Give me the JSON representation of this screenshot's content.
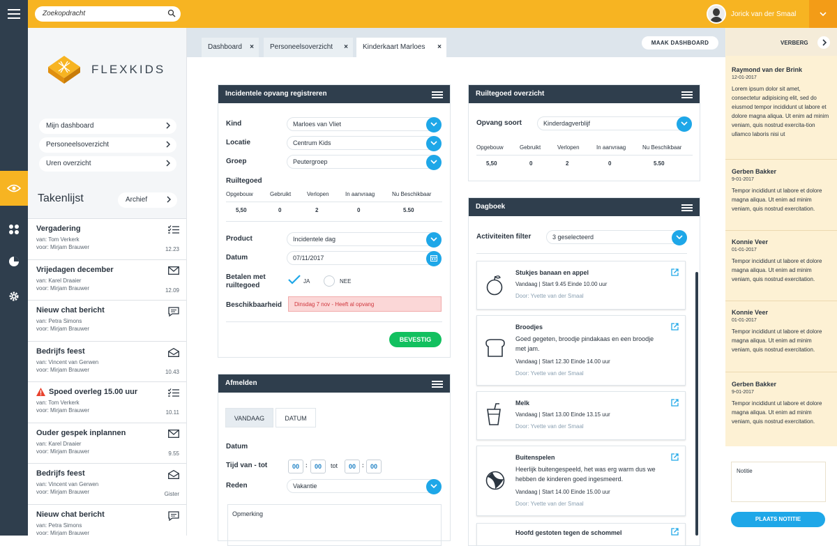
{
  "colors": {
    "accent": "#f7b422",
    "dark": "#2f3e4d",
    "blue": "#1ea7e8",
    "green": "#12c05f",
    "danger": "#d0363d"
  },
  "topbar": {
    "search_placeholder": "Zoekopdracht",
    "user_name": "Jorick van der Smaal"
  },
  "brand": {
    "name": "FLEXKIDS"
  },
  "nav": [
    {
      "label": "Mijn dashboard"
    },
    {
      "label": "Personeelsoverzicht"
    },
    {
      "label": "Uren overzicht"
    }
  ],
  "tasklist": {
    "title": "Takenlijst",
    "archive": "Archief",
    "items": [
      {
        "title": "Vergadering",
        "van": "van: Tom Verkerk",
        "voor": "voor: Mirjam Brauwer",
        "date": "12.23",
        "icon": "list-icon"
      },
      {
        "title": "Vrijedagen december",
        "van": "van: Karel Draaier",
        "voor": "voor: Mirjam Brauwer",
        "date": "12.09",
        "icon": "envelope-icon"
      },
      {
        "title": "Nieuw chat bericht",
        "van": "van:  Petra Simons",
        "voor": "voor: Mirjam Brauwer",
        "date": "",
        "icon": "chat-icon"
      },
      {
        "title": "Bedrijfs feest",
        "van": "van:  Vincent van Gerwen",
        "voor": "voor: Mirjam Brauwer",
        "date": "10.43",
        "icon": "open-envelope-icon"
      },
      {
        "title": "Spoed overleg 15.00 uur",
        "van": "van: Tom Verkerk",
        "voor": "voor: Mirjam Brauwer",
        "date": "10.11",
        "icon": "list-icon"
      },
      {
        "title": "Ouder gespek inplannen",
        "van": "van: Karel Draaier",
        "voor": "voor: Mirjam Brauwer",
        "date": "9.55",
        "icon": "envelope-icon"
      },
      {
        "title": "Bedrijfs feest",
        "van": "van:  Vincent van Gerwen",
        "voor": "voor: Mirjam Brauwer",
        "date": "Gister",
        "icon": "open-envelope-icon"
      },
      {
        "title": "Nieuw chat bericht",
        "van": "van:  Petra Simons",
        "voor": "voor: Mirjam Brauwer",
        "date": "",
        "icon": "chat-icon"
      }
    ]
  },
  "tabs": [
    {
      "label": "Dashboard"
    },
    {
      "label": "Personeelsoverzicht"
    },
    {
      "label": "Kinderkaart Marloes"
    }
  ],
  "make_dashboard": "MAAK DASHBOARD",
  "incidenteel": {
    "title": "Incidentele opvang registreren",
    "kind_label": "Kind",
    "kind_value": "Marloes van Vliet",
    "locatie_label": "Locatie",
    "locatie_value": "Centrum Kids",
    "groep_label": "Groep",
    "groep_value": "Peutergroep",
    "ruiltegoed_label": "Ruiltegoed",
    "cols": [
      "Opgebouw",
      "Gebruikt",
      "Verlopen",
      "In aanvraag",
      "Nu Beschikbaar"
    ],
    "vals": [
      "5,50",
      "0",
      "2",
      "0",
      "5.50"
    ],
    "product_label": "Product",
    "product_value": "Incidentele dag",
    "datum_label": "Datum",
    "datum_value": "07/11/2017",
    "betalen_label_1": "Betalen met",
    "betalen_label_2": "ruiltegoed",
    "ja": "JA",
    "nee": "NEE",
    "beschikbaarheid_label": "Beschikbaarheid",
    "beschikbaarheid_value": "Dinsdag 7 nov  -  Heeft al opvang",
    "confirm": "BEVESTIG"
  },
  "afmelden": {
    "title": "Afmelden",
    "tab_today": "VANDAAG",
    "tab_date": "DATUM",
    "datum_label": "Datum",
    "tijd_label": "Tijd van - tot",
    "tot": "tot",
    "time": [
      "00",
      "00",
      "00",
      "00"
    ],
    "reden_label": "Reden",
    "reden_value": "Vakantie",
    "opmerking": "Opmerking"
  },
  "ruiltegoed": {
    "title": "Ruiltegoed overzicht",
    "soort_label": "Opvang soort",
    "soort_value": "Kinderdagverblijf",
    "cols": [
      "Opgebouw",
      "Gebruikt",
      "Verlopen",
      "In aanvraag",
      "Nu Beschikbaar"
    ],
    "vals": [
      "5,50",
      "0",
      "2",
      "0",
      "5.50"
    ]
  },
  "dagboek": {
    "title": "Dagboek",
    "filter_label": "Activiteiten filter",
    "filter_value": "3 geselecteerd",
    "items": [
      {
        "title": "Stukjes banaan en appel",
        "desc": "",
        "meta": "Vandaag  |  Start 9.45 Einde 10.00 uur",
        "by": "Door: Yvette van der Smaal",
        "icon": "apple-icon"
      },
      {
        "title": "Broodjes",
        "desc": "Goed gegeten, broodje pindakaas en een broodje met jam.",
        "meta": "Vandaag  |  Start 12.30 Einde 14.00 uur",
        "by": "Door: Yvette van der Smaal",
        "icon": "bread-icon"
      },
      {
        "title": "Melk",
        "desc": "",
        "meta": "Vandaag  |  Start 13.00 Einde 13.15 uur",
        "by": "Door: Yvette van der Smaal",
        "icon": "cup-icon"
      },
      {
        "title": "Buitenspelen",
        "desc": "Heerlijk buitengespeeld, het was erg warm dus we hebben de kinderen goed ingesmeerd.",
        "meta": "Vandaag  |  Start 14.00 Einde 15.00 uur",
        "by": "Door: Yvette van der Smaal",
        "icon": "ball-icon"
      },
      {
        "title": "Hoofd gestoten tegen de schommel",
        "desc": "",
        "meta": "",
        "by": "",
        "icon": "bandage-icon"
      }
    ]
  },
  "notes": {
    "hide": "VERBERG",
    "items": [
      {
        "name": "Raymond van der Brink",
        "date": "12-01-2017",
        "text": "Lorem ipsum dolor sit amet, consectetur adipisicing elit, sed do eiusmod tempor incididunt ut labore et dolore magna aliqua. Ut enim ad minim veniam, quis nostrud exercita-tion ullamco laboris nisi ut"
      },
      {
        "name": "Gerben Bakker",
        "date": "9-01-2017",
        "text": "Tempor incididunt ut labore et dolore magna aliqua. Ut enim ad minim veniam, quis nostrud exercitation."
      },
      {
        "name": "Konnie Veer",
        "date": "01-01-2017",
        "text": "Tempor incididunt ut labore et dolore magna aliqua. Ut enim ad minim veniam, quis nostrud exercitation."
      },
      {
        "name": "Konnie Veer",
        "date": "01-01-2017",
        "text": "Tempor incididunt ut labore et dolore magna aliqua. Ut enim ad minim veniam, quis nostrud exercitation."
      },
      {
        "name": "Gerben Bakker",
        "date": "9-01-2017",
        "text": "Tempor incididunt ut labore et dolore magna aliqua. Ut enim ad minim veniam, quis nostrud exercitation."
      }
    ],
    "placeholder": "Notitie",
    "submit": "PLAATS NOTITIE"
  }
}
